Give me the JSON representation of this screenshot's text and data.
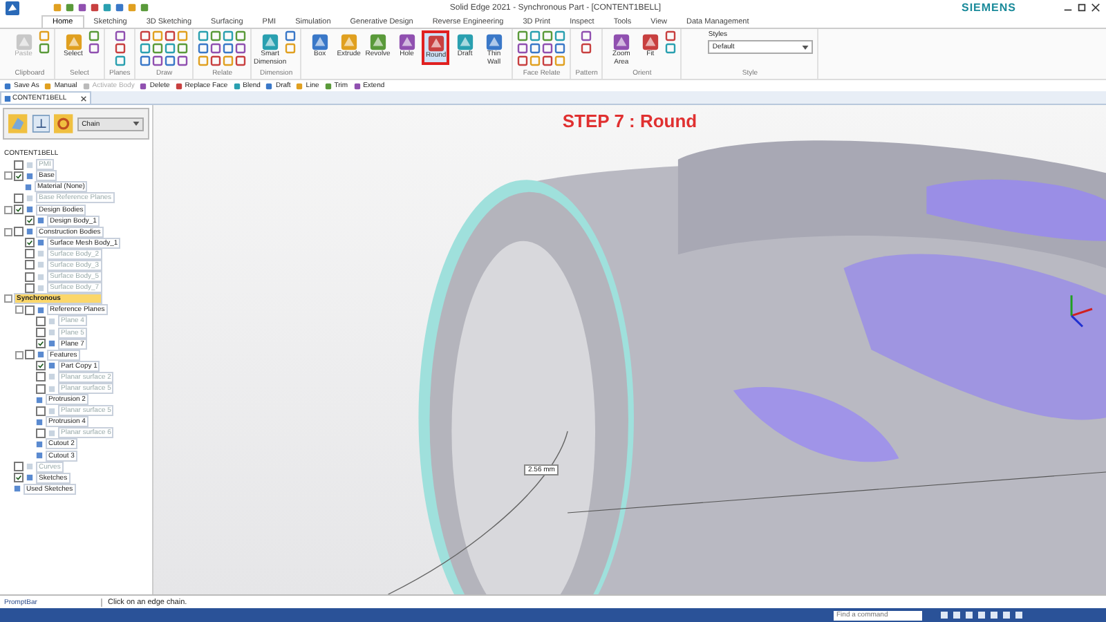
{
  "window": {
    "title": "Solid Edge 2021 - Synchronous Part - [CONTENT1BELL]",
    "brand": "SIEMENS"
  },
  "ribbon_tabs": [
    {
      "label": "Home",
      "selected": true
    },
    {
      "label": "Sketching",
      "selected": false
    },
    {
      "label": "3D Sketching",
      "selected": false
    },
    {
      "label": "Surfacing",
      "selected": false
    },
    {
      "label": "PMI",
      "selected": false
    },
    {
      "label": "Simulation",
      "selected": false
    },
    {
      "label": "Generative Design",
      "selected": false
    },
    {
      "label": "Reverse Engineering",
      "selected": false
    },
    {
      "label": "3D Print",
      "selected": false
    },
    {
      "label": "Inspect",
      "selected": false
    },
    {
      "label": "Tools",
      "selected": false
    },
    {
      "label": "View",
      "selected": false
    },
    {
      "label": "Data Management",
      "selected": false
    }
  ],
  "ribbon_groups": [
    {
      "label": "Clipboard",
      "buttons": [
        {
          "label": "Paste",
          "highlighted": false,
          "disabled": true
        }
      ]
    },
    {
      "label": "Select",
      "buttons": [
        {
          "label": "Select",
          "highlighted": false,
          "disabled": false
        }
      ]
    },
    {
      "label": "Planes"
    },
    {
      "label": "Draw"
    },
    {
      "label": "Relate"
    },
    {
      "label": "Dimension",
      "buttons": [
        {
          "label": "Smart Dimension",
          "highlighted": false,
          "disabled": false
        }
      ]
    },
    {
      "buttons": [
        {
          "label": "Box",
          "highlighted": false,
          "disabled": false
        },
        {
          "label": "Extrude",
          "highlighted": false,
          "disabled": false
        },
        {
          "label": "Revolve",
          "highlighted": false,
          "disabled": false
        },
        {
          "label": "Hole",
          "highlighted": false,
          "disabled": false
        },
        {
          "label": "Round",
          "highlighted": true,
          "disabled": false
        },
        {
          "label": "Draft",
          "highlighted": false,
          "disabled": false
        },
        {
          "label": "Thin Wall",
          "highlighted": false,
          "disabled": false
        }
      ]
    },
    {
      "label": "Face Relate"
    },
    {
      "label": "Pattern"
    },
    {
      "label": "Orient",
      "buttons": [
        {
          "label": "Zoom Area",
          "highlighted": false,
          "disabled": false
        },
        {
          "label": "Fit",
          "highlighted": false,
          "disabled": false
        }
      ]
    },
    {
      "label": "Style",
      "styles_label": "Styles",
      "style_value": "Default"
    }
  ],
  "command_bar": [
    {
      "label": "Save As",
      "disabled": false
    },
    {
      "label": "Manual",
      "disabled": false
    },
    {
      "label": "Activate Body",
      "disabled": true
    },
    {
      "label": "Delete",
      "disabled": false
    },
    {
      "label": "Replace Face",
      "disabled": false
    },
    {
      "label": "Blend",
      "disabled": false
    },
    {
      "label": "Draft",
      "disabled": false
    },
    {
      "label": "Line",
      "disabled": false
    },
    {
      "label": "Trim",
      "disabled": false
    },
    {
      "label": "Extend",
      "disabled": false
    }
  ],
  "document_tab": {
    "label": "CONTENT1BELL"
  },
  "selection_toolbar": {
    "mode": "Chain"
  },
  "tree": {
    "label": "CONTENT1BELL",
    "children": [
      {
        "label": "PMI",
        "kind": "checkbox",
        "checked": false,
        "dimmed": true,
        "selected": false
      },
      {
        "label": "Base",
        "kind": "checkbox",
        "checked": true,
        "dimmed": false,
        "selected": false,
        "children": [
          {
            "label": "Material (None)",
            "kind": "plain",
            "dimmed": false,
            "selected": false
          }
        ]
      },
      {
        "label": "Base Reference Planes",
        "kind": "checkbox",
        "checked": false,
        "dimmed": true,
        "selected": false
      },
      {
        "label": "Design Bodies",
        "kind": "checkbox",
        "checked": true,
        "dimmed": false,
        "selected": false,
        "children": [
          {
            "label": "Design Body_1",
            "kind": "checkbox",
            "checked": true,
            "dimmed": false,
            "selected": false
          }
        ]
      },
      {
        "label": "Construction Bodies",
        "kind": "checkbox",
        "checked": false,
        "dimmed": false,
        "selected": false,
        "children": [
          {
            "label": "Surface Mesh Body_1",
            "kind": "checkbox",
            "checked": true,
            "dimmed": false,
            "selected": false
          },
          {
            "label": "Surface Body_2",
            "kind": "checkbox",
            "checked": false,
            "dimmed": true,
            "selected": false
          },
          {
            "label": "Surface Body_3",
            "kind": "checkbox",
            "checked": false,
            "dimmed": true,
            "selected": false
          },
          {
            "label": "Surface Body_5",
            "kind": "checkbox",
            "checked": false,
            "dimmed": true,
            "selected": false
          },
          {
            "label": "Surface Body_7",
            "kind": "checkbox",
            "checked": false,
            "dimmed": true,
            "selected": false
          }
        ]
      },
      {
        "label": "Synchronous",
        "kind": "group",
        "dimmed": false,
        "selected": true,
        "children": [
          {
            "label": "Reference Planes",
            "kind": "checkbox",
            "checked": false,
            "dimmed": false,
            "selected": false,
            "children": [
              {
                "label": "Plane 4",
                "kind": "checkbox",
                "checked": false,
                "dimmed": true,
                "selected": false
              },
              {
                "label": "Plane 5",
                "kind": "checkbox",
                "checked": false,
                "dimmed": true,
                "selected": false
              },
              {
                "label": "Plane 7",
                "kind": "checkbox",
                "checked": true,
                "dimmed": false,
                "selected": false
              }
            ]
          },
          {
            "label": "Features",
            "kind": "checkbox",
            "checked": false,
            "dimmed": false,
            "selected": false,
            "children": [
              {
                "label": "Part Copy 1",
                "kind": "checkbox",
                "checked": true,
                "dimmed": false,
                "selected": false
              },
              {
                "label": "Planar surface 2",
                "kind": "checkbox",
                "checked": false,
                "dimmed": true,
                "selected": false
              },
              {
                "label": "Planar surface 5",
                "kind": "checkbox",
                "checked": false,
                "dimmed": true,
                "selected": false
              },
              {
                "label": "Protrusion 2",
                "kind": "plain",
                "dimmed": false,
                "selected": false
              },
              {
                "label": "Planar surface 5",
                "kind": "checkbox",
                "checked": false,
                "dimmed": true,
                "selected": false
              },
              {
                "label": "Protrusion 4",
                "kind": "plain",
                "dimmed": false,
                "selected": false
              },
              {
                "label": "Planar surface 6",
                "kind": "checkbox",
                "checked": false,
                "dimmed": true,
                "selected": false
              },
              {
                "label": "Cutout 2",
                "kind": "plain",
                "dimmed": false,
                "selected": false
              },
              {
                "label": "Cutout 3",
                "kind": "plain",
                "dimmed": false,
                "selected": false
              }
            ]
          }
        ]
      },
      {
        "label": "Curves",
        "kind": "checkbox",
        "checked": false,
        "dimmed": true,
        "selected": false
      },
      {
        "label": "Sketches",
        "kind": "checkbox",
        "checked": true,
        "dimmed": false,
        "selected": false
      },
      {
        "label": "Used Sketches",
        "kind": "plain",
        "dimmed": false,
        "selected": false
      }
    ]
  },
  "viewport": {
    "heading": "STEP 7 : Round",
    "dimension": "2.56 mm"
  },
  "prompt_bar": {
    "label": "PromptBar",
    "message": "Click on an edge chain."
  },
  "status_bar": {
    "search": {
      "placeholder": "Find a command"
    }
  }
}
